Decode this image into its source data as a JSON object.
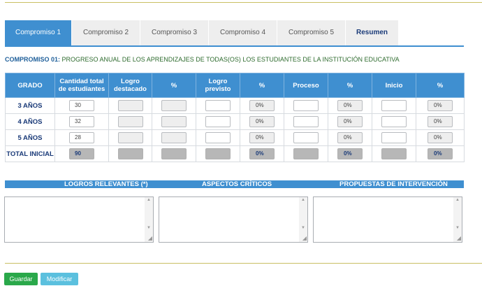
{
  "tabs": [
    {
      "label": "Compromiso 1"
    },
    {
      "label": "Compromiso 2"
    },
    {
      "label": "Compromiso 3"
    },
    {
      "label": "Compromiso 4"
    },
    {
      "label": "Compromiso 5"
    },
    {
      "label": "Resumen"
    }
  ],
  "heading": {
    "code": "COMPROMISO 01:",
    "text": " PROGRESO ANUAL DE LOS APRENDIZAJES DE TODAS(OS) LOS ESTUDIANTES DE LA INSTITUCIÓN EDUCATIVA"
  },
  "table": {
    "headers": [
      "GRADO",
      "Cantidad total de estudiantes",
      "Logro destacado",
      "%",
      "Logro previsto",
      "%",
      "Proceso",
      "%",
      "Inicio",
      "%"
    ],
    "rows": [
      {
        "grade": "3 AÑOS",
        "total": "30",
        "pct1": "0%",
        "pct2": "0%",
        "pct3": "0%"
      },
      {
        "grade": "4 AÑOS",
        "total": "32",
        "pct1": "0%",
        "pct2": "0%",
        "pct3": "0%"
      },
      {
        "grade": "5 AÑOS",
        "total": "28",
        "pct1": "0%",
        "pct2": "0%",
        "pct3": "0%"
      }
    ],
    "total_row": {
      "grade": "TOTAL INICIAL",
      "total": "90",
      "pct1": "0%",
      "pct2": "0%",
      "pct3": "0%"
    }
  },
  "sections": {
    "logros": "LOGROS RELEVANTES (*)",
    "aspectos": "ASPECTOS CRÍTICOS",
    "propuestas": "PROPUESTAS DE INTERVENCIÓN"
  },
  "buttons": {
    "save": "Guardar",
    "modify": "Modificar"
  },
  "colors": {
    "accent": "#3f8fd0",
    "save": "#2aa84a",
    "modify": "#5bc0de",
    "rule": "#c9bf63"
  }
}
